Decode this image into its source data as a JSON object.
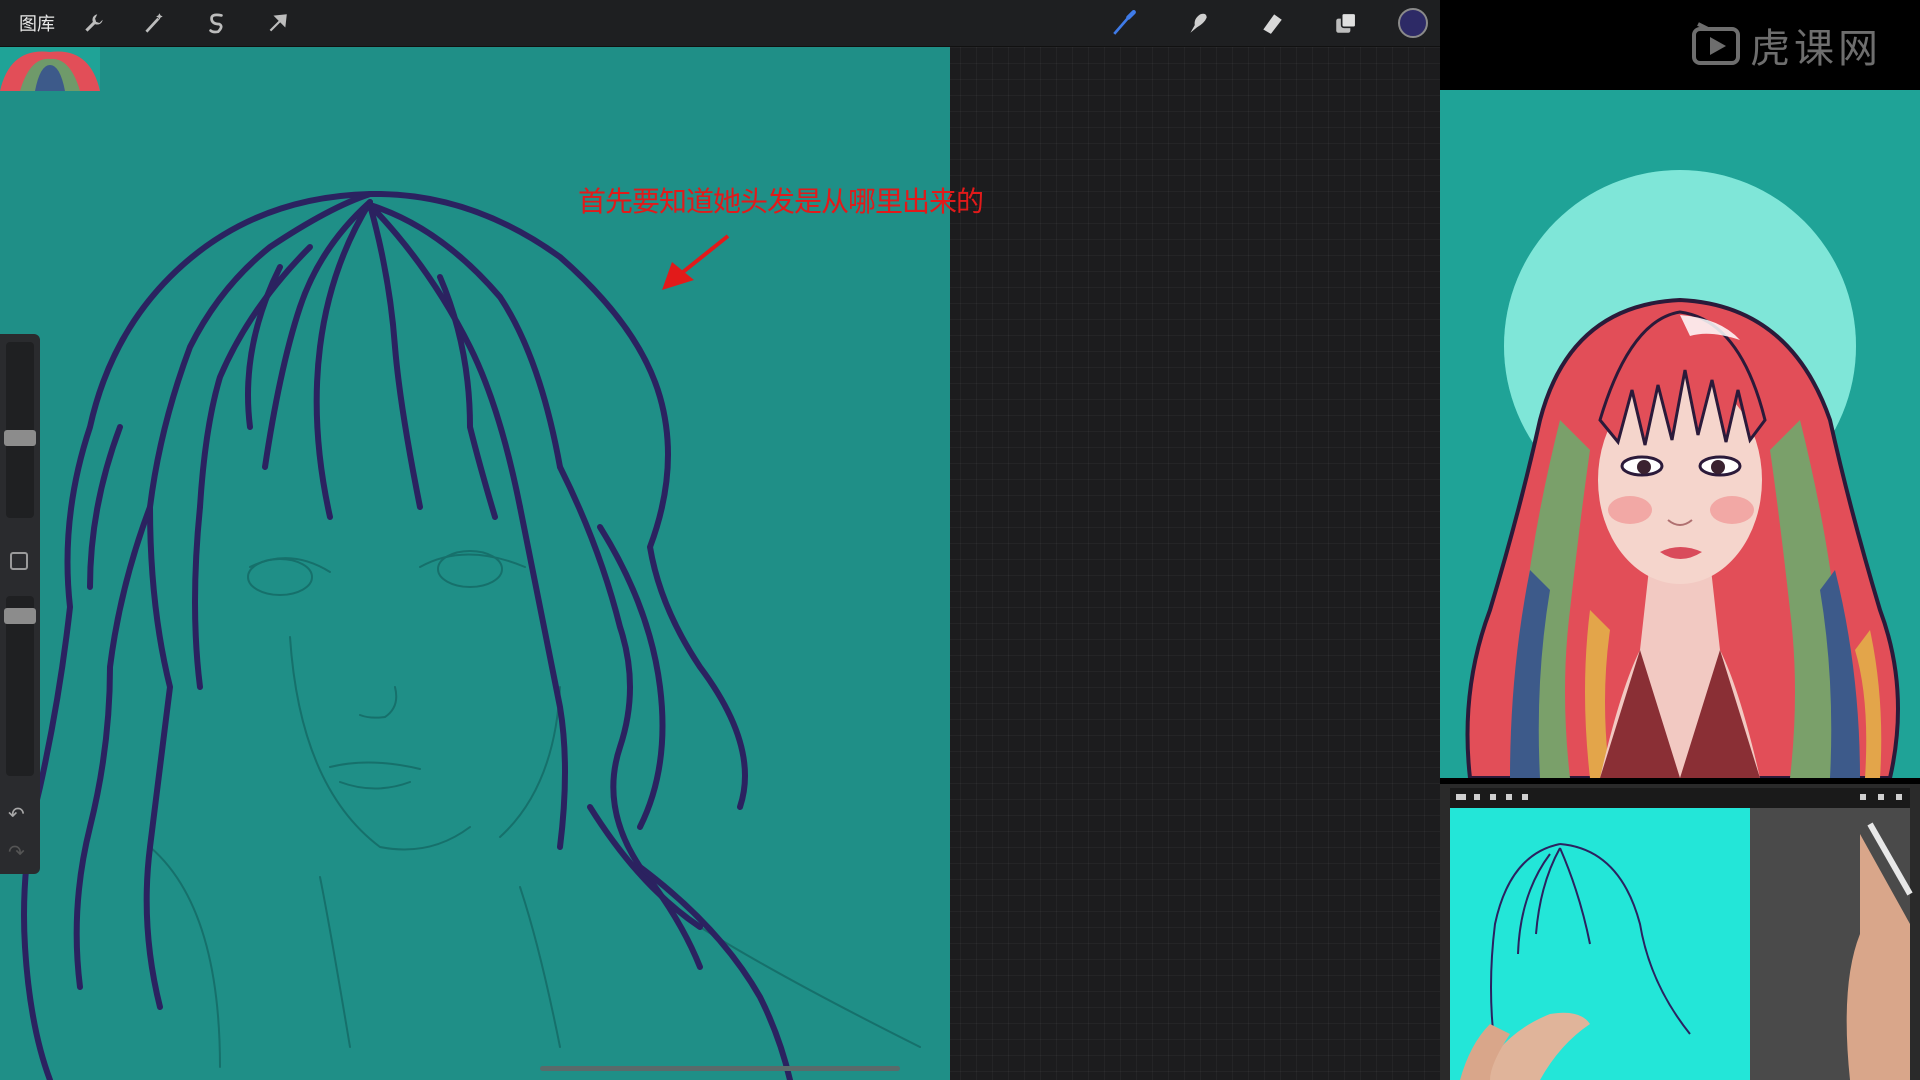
{
  "toolbar": {
    "gallery_label": "图库",
    "icons": [
      "wrench-icon",
      "magic-wand-icon",
      "selection-icon",
      "transform-arrow-icon",
      "brush-icon",
      "smudge-icon",
      "eraser-icon",
      "layers-icon"
    ],
    "current_color": "#2d2a66"
  },
  "canvas": {
    "background": "#1f8f87",
    "annotation_text": "首先要知道她头发是从哪里出来的",
    "annotation_color": "#e21a1a"
  },
  "sidebar": {
    "undo_icon": "↶",
    "redo_icon": "↷"
  },
  "watermark": {
    "text": "虎课网"
  },
  "colors": {
    "workspace": "#1c1c1e",
    "toolbar": "#1e1f21",
    "reference_bg": "#1fa397",
    "hair_red": "#e24e58",
    "line_art": "#2b2260"
  }
}
